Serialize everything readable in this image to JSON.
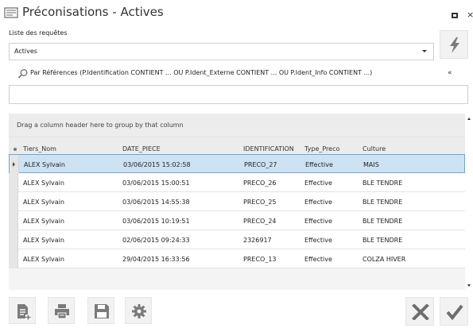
{
  "window": {
    "title": "Préconisations - Actives",
    "close_glyph": "×"
  },
  "requests": {
    "label": "Liste des requêtes",
    "selected": "Actives"
  },
  "filter": {
    "text": "Par Références (P.Identification CONTIENT ... OU P.Ident_Externe CONTIENT ... OU P.Ident_Info CONTIENT ...)",
    "collapse_glyph": "«",
    "value": ""
  },
  "grid": {
    "group_panel_text": "Drag a column header here to group by that column",
    "columns": [
      "Tiers_Nom",
      "DATE_PIECE",
      "IDENTIFICATION",
      "Type_Preco",
      "Culture"
    ],
    "rows": [
      [
        "ALEX Sylvain",
        "03/06/2015 15:02:58",
        "PRECO_27",
        "Effective",
        "MAIS"
      ],
      [
        "ALEX Sylvain",
        "03/06/2015 15:00:51",
        "PRECO_26",
        "Effective",
        "BLE TENDRE"
      ],
      [
        "ALEX Sylvain",
        "03/06/2015 14:55:38",
        "PRECO_25",
        "Effective",
        "BLE TENDRE"
      ],
      [
        "ALEX Sylvain",
        "03/06/2015 10:19:51",
        "PRECO_24",
        "Effective",
        "BLE TENDRE"
      ],
      [
        "ALEX Sylvain",
        "02/06/2015 09:24:33",
        "2326917",
        "Effective",
        "BLE TENDRE"
      ],
      [
        "ALEX Sylvain",
        "29/04/2015 16:33:56",
        "PRECO_13",
        "Effective",
        "COLZA HIVER"
      ]
    ],
    "selected_row": 0
  },
  "toolbar": {
    "icons": [
      "new-document-icon",
      "print-icon",
      "save-icon",
      "settings-icon"
    ]
  },
  "actions": {
    "icons": [
      "cancel-icon",
      "validate-icon"
    ]
  },
  "colors": {
    "selected_row": "#cde2f3",
    "selected_border": "#6ea7d8",
    "icon_gray": "#7a7a7a"
  }
}
